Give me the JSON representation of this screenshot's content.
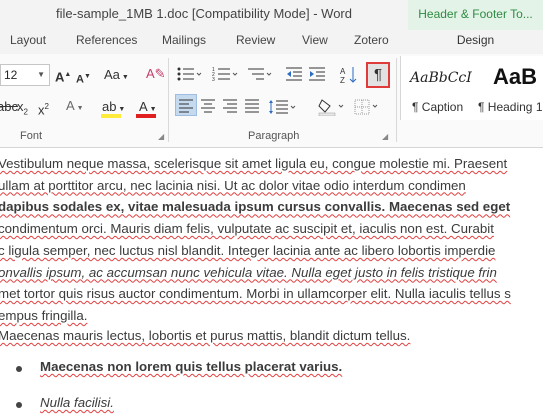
{
  "window": {
    "title": "file-sample_1MB 1.doc [Compatibility Mode] - Word",
    "contextual_tab_group": "Header & Footer To..."
  },
  "tabs": [
    "Layout",
    "References",
    "Mailings",
    "Review",
    "View",
    "Zotero"
  ],
  "contextual_tab": "Design",
  "ribbon": {
    "font_size": "12",
    "font_group_label": "Font",
    "paragraph_group_label": "Paragraph",
    "styles": [
      {
        "preview": "AaBbCcI",
        "name": "¶ Caption"
      },
      {
        "preview": "AaB",
        "name": "¶ Heading 1"
      }
    ],
    "colors": {
      "highlight": "#ffeb3b",
      "font_color": "#e02020",
      "contextual": "#2e8b44",
      "show_hide_outline": "#e03b3b"
    }
  },
  "document": {
    "para1_lines": [
      "Vestibulum neque massa, scelerisque sit amet ligula eu, congue molestie mi. Praesent",
      "ullam at porttitor arcu, nec lacinia nisi. Ut ac dolor vitae odio interdum condimen",
      "dapibus sodales ex, vitae malesuada ipsum cursus convallis. Maecenas sed eget",
      "condimentum orci. Mauris diam felis, vulputate ac suscipit et, iaculis non est. Curabit",
      "c ligula semper, nec luctus nisl blandit. Integer lacinia ante ac libero lobortis imperdie",
      "onvallis ipsum, ac accumsan nunc vehicula vitae. Nulla eget justo in felis tristique frin",
      "met tortor quis risus auctor condimentum. Morbi in ullamcorper elit. Nulla iaculis tellus s",
      "empus fringilla."
    ],
    "para2": "Maecenas mauris lectus, lobortis et purus mattis, blandit dictum tellus.",
    "bullet1": "Maecenas non lorem quis tellus placerat varius.",
    "bullet2": "Nulla facilisi."
  }
}
